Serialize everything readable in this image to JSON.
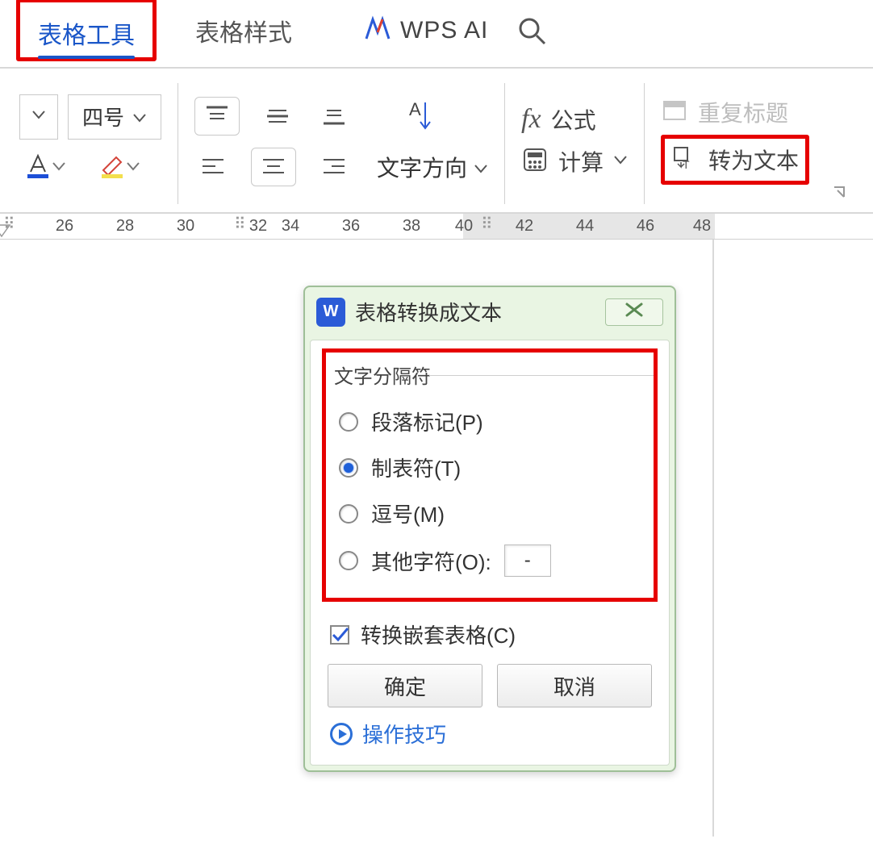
{
  "tabs": {
    "table_tools": "表格工具",
    "table_style": "表格样式",
    "ai_label": "WPS AI"
  },
  "toolbar": {
    "font_size": "四号",
    "text_direction": "文字方向",
    "formula": "公式",
    "calculate": "计算",
    "repeat_header": "重复标题",
    "convert_to_text": "转为文本"
  },
  "ruler": {
    "numbers": [
      "26",
      "28",
      "30",
      "32",
      "34",
      "36",
      "38",
      "40",
      "42",
      "44",
      "46",
      "48"
    ]
  },
  "dialog": {
    "title": "表格转换成文本",
    "section": "文字分隔符",
    "opt_paragraph": "段落标记(P)",
    "opt_tab": "制表符(T)",
    "opt_comma": "逗号(M)",
    "opt_other": "其他字符(O):",
    "other_value": "-",
    "nested": "转换嵌套表格(C)",
    "ok": "确定",
    "cancel": "取消",
    "tips": "操作技巧"
  }
}
